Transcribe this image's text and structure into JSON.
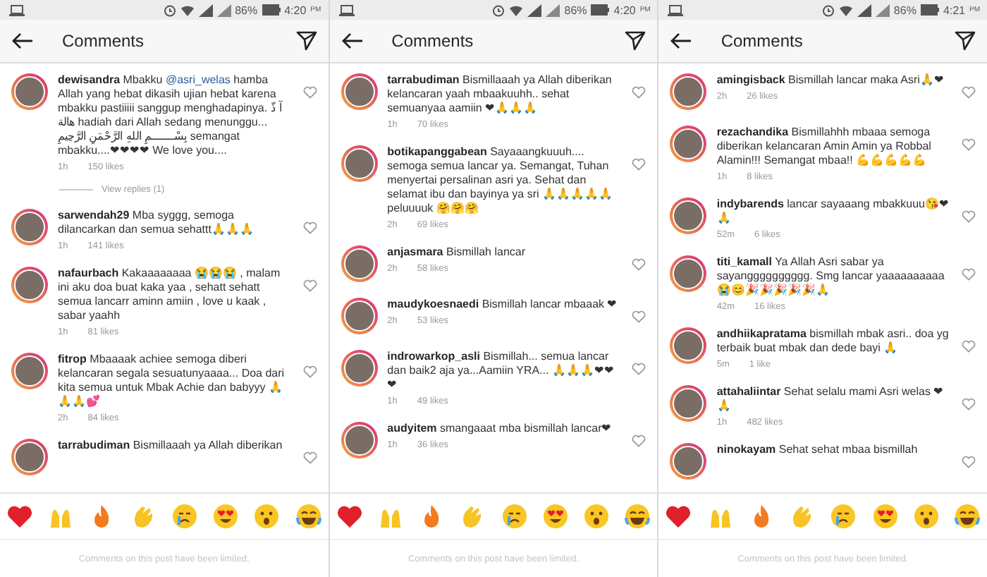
{
  "panels": [
    {
      "status": {
        "battery": "86%",
        "time": "4:20",
        "ampm": "PM"
      },
      "header": {
        "title": "Comments"
      },
      "comments": [
        {
          "kind": "comment",
          "user": "dewisandra",
          "text": "Mbakku",
          "mention": "@asri_welas",
          "text_after": "hamba Allah yang hebat dikasih ujian hebat karena mbakku pastiiiii sanggup menghadapinya. آ ذّ هالة hadiah dari Allah sedang menunggu... بِسْــــــــمِ اللهِ الرَّحْمَنِ الرَّحِيمِ semangat mbakku....❤❤❤❤ We love you....",
          "time": "1h",
          "likes": "150 likes"
        },
        {
          "kind": "replies",
          "label": "View replies (1)"
        },
        {
          "kind": "comment",
          "user": "sarwendah29",
          "text": "Mba syggg, semoga dilancarkan dan semua sehattt🙏🙏🙏",
          "time": "1h",
          "likes": "141 likes"
        },
        {
          "kind": "comment",
          "user": "nafaurbach",
          "text": "Kakaaaaaaaa 😭😭😭 , malam ini aku doa buat kaka yaa , sehatt sehatt semua lancarr aminn amiin , love u kaak , sabar yaahh",
          "time": "1h",
          "likes": "81 likes"
        },
        {
          "kind": "comment",
          "user": "fitrop",
          "text": "Mbaaaak achiee semoga diberi kelancaran segala sesuatunyaaaa... Doa dari kita semua untuk Mbak Achie dan babyyy 🙏🙏🙏💕",
          "time": "2h",
          "likes": "84 likes"
        },
        {
          "kind": "comment",
          "user": "tarrabudiman",
          "text": "Bismillaaah ya Allah diberikan"
        }
      ],
      "footer": "Comments on this post have been limited."
    },
    {
      "status": {
        "battery": "86%",
        "time": "4:20",
        "ampm": "PM"
      },
      "header": {
        "title": "Comments"
      },
      "comments": [
        {
          "kind": "comment",
          "user": "tarrabudiman",
          "text": "Bismillaaah ya Allah diberikan kelancaran yaah mbaakuuhh.. sehat semuanyaa aamiin ❤🙏🙏🙏",
          "time": "1h",
          "likes": "70 likes"
        },
        {
          "kind": "comment",
          "user": "botikapanggabean",
          "text": "Sayaaangkuuuh.... semoga semua lancar ya. Semangat, Tuhan menyertai persalinan asri ya. Sehat dan selamat ibu dan bayinya ya sri 🙏🙏🙏🙏🙏 peluuuuk 🤗🤗🤗",
          "time": "2h",
          "likes": "69 likes"
        },
        {
          "kind": "comment",
          "user": "anjasmara",
          "text": "Bismillah lancar",
          "time": "2h",
          "likes": "58 likes"
        },
        {
          "kind": "comment",
          "user": "maudykoesnaedi",
          "text": "Bismillah lancar mbaaak ❤",
          "time": "2h",
          "likes": "53 likes"
        },
        {
          "kind": "comment",
          "user": "indrowarkop_asli",
          "text": "Bismillah... semua lancar dan baik2 aja ya...Aamiin YRA... 🙏🙏🙏❤❤❤",
          "time": "1h",
          "likes": "49 likes"
        },
        {
          "kind": "comment",
          "user": "audyitem",
          "text": "smangaaat mba bismillah lancar❤",
          "time": "1h",
          "likes": "36 likes"
        }
      ],
      "footer": "Comments on this post have been limited."
    },
    {
      "status": {
        "battery": "86%",
        "time": "4:21",
        "ampm": "PM"
      },
      "header": {
        "title": "Comments"
      },
      "comments": [
        {
          "kind": "comment",
          "user": "amingisback",
          "text": "Bismillah lancar maka Asri🙏❤",
          "time": "2h",
          "likes": "26 likes"
        },
        {
          "kind": "comment",
          "user": "rezachandika",
          "text": "Bismillahhh mbaaa semoga diberikan kelancaran Amin Amin ya Robbal Alamin!!! Semangat mbaa!! 💪💪💪💪💪",
          "time": "1h",
          "likes": "8 likes"
        },
        {
          "kind": "comment",
          "user": "indybarends",
          "text": "lancar sayaaang mbakkuuu😘❤🙏",
          "time": "52m",
          "likes": "6 likes"
        },
        {
          "kind": "comment",
          "user": "titi_kamall",
          "text": "Ya Allah Asri sabar ya sayangggggggggg. Smg lancar yaaaaaaaaaa 😭😊🎉🎉🎉🎉🎉🙏",
          "time": "42m",
          "likes": "16 likes"
        },
        {
          "kind": "comment",
          "user": "andhiikapratama",
          "text": "bismillah mbak asri.. doa yg terbaik buat mbak dan dede bayi 🙏",
          "time": "5m",
          "likes": "1 like"
        },
        {
          "kind": "comment",
          "user": "attahaliintar",
          "text": "Sehat selalu mami Asri welas ❤🙏",
          "time": "1h",
          "likes": "482 likes"
        },
        {
          "kind": "comment",
          "user": "ninokayam",
          "text": "Sehat sehat mbaa bismillah"
        }
      ],
      "footer": "Comments on this post have been limited."
    }
  ]
}
